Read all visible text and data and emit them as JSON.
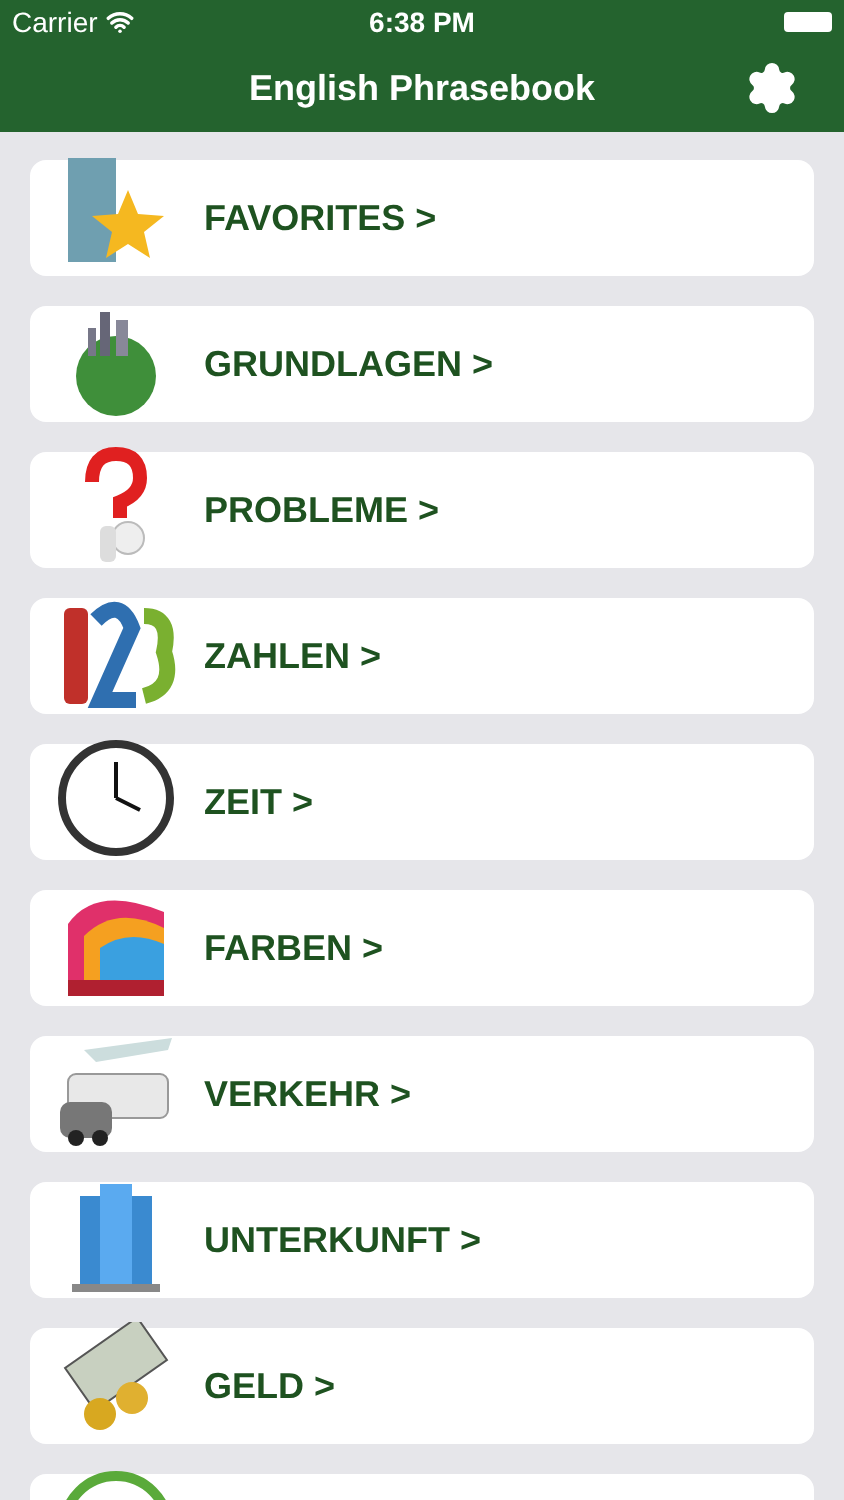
{
  "status_bar": {
    "carrier": "Carrier",
    "time": "6:38 PM"
  },
  "nav_bar": {
    "title": "English Phrasebook"
  },
  "categories": [
    {
      "kind": "labeled",
      "label": "FAVORITES >"
    },
    {
      "kind": "labeled",
      "label": "GRUNDLAGEN >"
    },
    {
      "kind": "labeled",
      "label": "PROBLEME >"
    },
    {
      "kind": "labeled",
      "label": "ZAHLEN >"
    },
    {
      "kind": "labeled",
      "label": "ZEIT >"
    },
    {
      "kind": "labeled",
      "label": "FARBEN >"
    },
    {
      "kind": "labeled",
      "label": "VERKEHR >"
    },
    {
      "kind": "labeled",
      "label": "UNTERKUNFT >"
    },
    {
      "kind": "labeled",
      "label": "GELD >"
    },
    {
      "kind": "cut_off"
    }
  ]
}
